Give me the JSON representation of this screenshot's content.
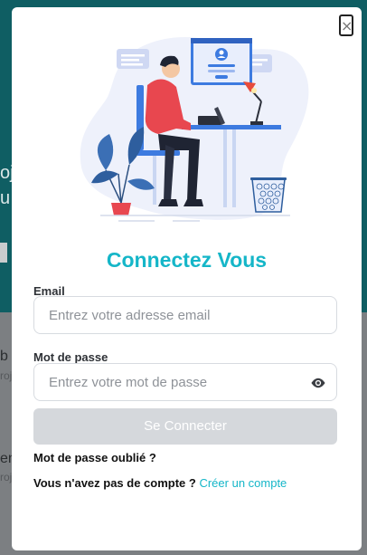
{
  "background": {
    "lines": [
      "oj",
      "u",
      "b",
      "roj",
      "en",
      "roj"
    ]
  },
  "modal": {
    "close_label": "×",
    "title": "Connectez Vous",
    "email": {
      "label": "Email",
      "placeholder": "Entrez votre adresse email",
      "value": ""
    },
    "password": {
      "label": "Mot de passe",
      "placeholder": "Entrez votre mot de passe",
      "value": "",
      "toggle_icon": "eye-icon"
    },
    "submit_label": "Se Connecter",
    "forgot_label": "Mot de passe oublié ?",
    "signup_question": "Vous n'avez pas de compte ?",
    "signup_link": "Créer un compte"
  },
  "colors": {
    "accent": "#15b6c8",
    "button_disabled": "#d5d8dc",
    "overlay_teal": "#0f5e63"
  }
}
